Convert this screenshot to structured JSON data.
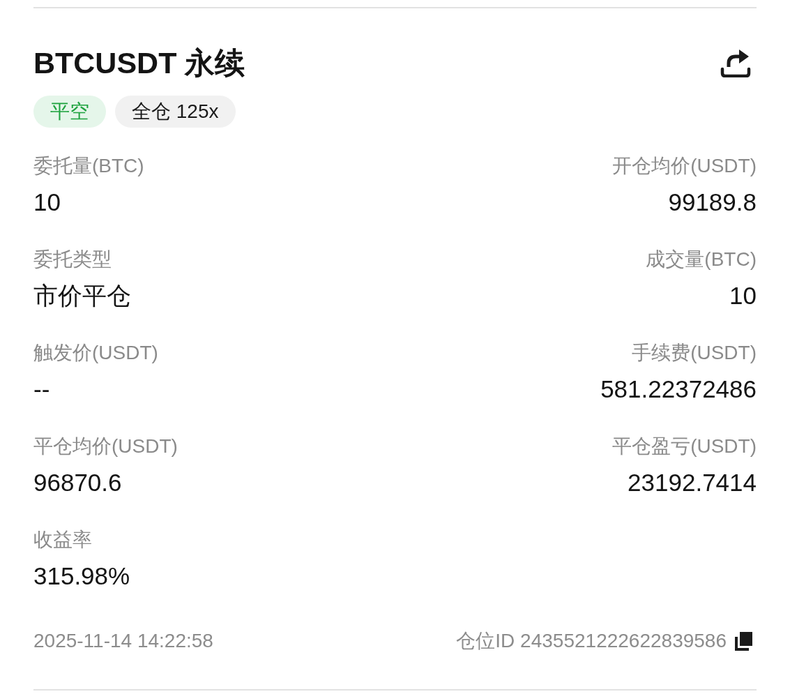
{
  "header": {
    "title": "BTCUSDT 永续",
    "tags": [
      {
        "label": "平空",
        "kind": "side"
      },
      {
        "label": "全仓 125x",
        "kind": "margin"
      }
    ]
  },
  "fields": [
    {
      "label": "委托量(BTC)",
      "value": "10"
    },
    {
      "label": "开仓均价(USDT)",
      "value": "99189.8"
    },
    {
      "label": "委托类型",
      "value": "市价平仓"
    },
    {
      "label": "成交量(BTC)",
      "value": "10"
    },
    {
      "label": "触发价(USDT)",
      "value": "--"
    },
    {
      "label": "手续费(USDT)",
      "value": "581.22372486"
    },
    {
      "label": "平仓均价(USDT)",
      "value": "96870.6"
    },
    {
      "label": "平仓盈亏(USDT)",
      "value": "23192.7414"
    },
    {
      "label": "收益率",
      "value": "315.98%"
    }
  ],
  "footer": {
    "time": "2025-11-14 14:22:58",
    "position_id": "仓位ID 2435521222622839586"
  }
}
